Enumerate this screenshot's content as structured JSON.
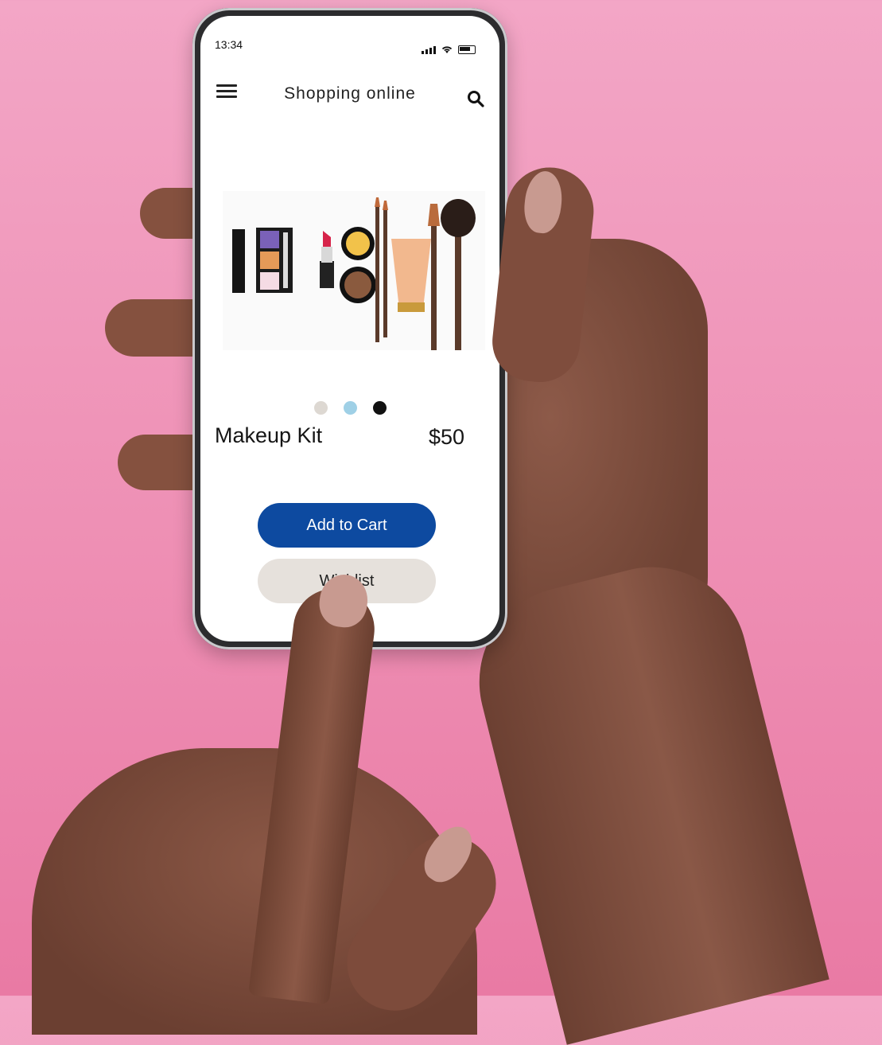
{
  "status_bar": {
    "time": "13:34"
  },
  "header": {
    "title": "Shopping online",
    "menu_icon": "hamburger-menu-icon",
    "search_icon": "search-icon"
  },
  "product": {
    "name": "Makeup Kit",
    "price": "$50",
    "image": "makeup-kit-product-image",
    "carousel": {
      "dot_colors": [
        "#ddd8d2",
        "#9fd0e6",
        "#111111"
      ]
    }
  },
  "actions": {
    "add_to_cart_label": "Add to Cart",
    "wishlist_label": "Wishlist"
  },
  "colors": {
    "background": "#f09ab9",
    "primary_button": "#0d4aa0",
    "secondary_button": "#e6e1dc"
  }
}
